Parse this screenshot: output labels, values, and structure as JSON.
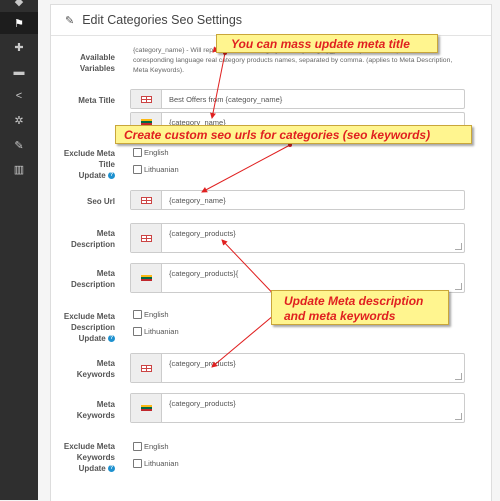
{
  "sidebar": {
    "items": [
      {
        "icon": "tags-icon"
      },
      {
        "icon": "flag-icon"
      },
      {
        "icon": "puzzle-icon"
      },
      {
        "icon": "cart-icon"
      },
      {
        "icon": "share-icon"
      },
      {
        "icon": "gear-icon"
      },
      {
        "icon": "wrench-icon"
      },
      {
        "icon": "bar-chart-icon"
      }
    ]
  },
  "panel": {
    "title": "Edit Categories Seo Settings"
  },
  "variables": {
    "label": "Available Variables",
    "text": "{category_name} - Will replace with the category name. {category_products} - Will be replace with the coresponding language real category products names, separated by comma. (applies to Meta Description, Meta Keywords)."
  },
  "meta_title": {
    "label": "Meta Title",
    "en_value": "Best Offers from {category_name}",
    "lt_value": "{category_name}"
  },
  "exclude_title": {
    "label_lines": [
      "Exclude Meta",
      "Title",
      "Update"
    ]
  },
  "seo_url": {
    "label": "Seo Url",
    "value": "{category_name}"
  },
  "meta_description": {
    "label_lines": [
      "Meta",
      "Description"
    ],
    "en_value": "{category_products}",
    "lt_value": "{category_products}{"
  },
  "exclude_description": {
    "label_lines": [
      "Exclude Meta",
      "Description",
      "Update"
    ]
  },
  "meta_keywords": {
    "label_lines": [
      "Meta",
      "Keywords"
    ],
    "en_value": "{category_products}",
    "lt_value": "{category_products}"
  },
  "exclude_keywords": {
    "label_lines": [
      "Exclude Meta",
      "Keywords",
      "Update"
    ]
  },
  "languages": {
    "english": "English",
    "lithuanian": "Lithuanian"
  },
  "callouts": {
    "meta_title": "You can mass update meta title",
    "seo_urls": "Create custom seo urls for categories (seo keywords)",
    "description_keywords_1": "Update Meta description",
    "description_keywords_2": "and meta keywords"
  },
  "colors": {
    "callout_bg": "#fff58f",
    "callout_text": "#e02020",
    "sidebar_bg": "#2f2f2f",
    "help_blue": "#1e91cf"
  }
}
